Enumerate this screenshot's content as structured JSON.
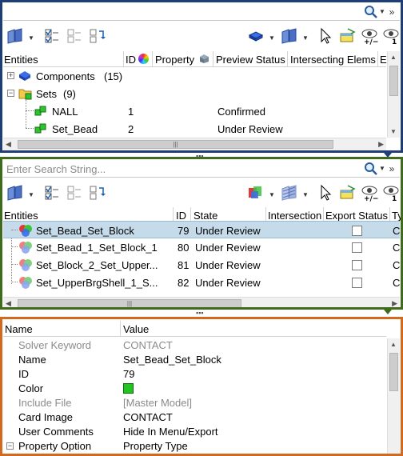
{
  "panel1": {
    "toolbar_icons": [
      "entity-view-icon",
      "check-all-icon",
      "check-none-icon",
      "reverse-check-icon",
      "cube-display-icon",
      "entity-filter-icon",
      "select-cursor-icon",
      "isolate-icon",
      "show-plus-minus-icon",
      "show-one-icon"
    ],
    "columns": [
      "Entities",
      "ID",
      "Property",
      "Preview Status",
      "Intersecting Elems",
      "Ex"
    ],
    "rows": [
      {
        "expander": "+",
        "name": "Components",
        "count": "(15)",
        "id": "",
        "status": ""
      },
      {
        "expander": "−",
        "name": "Sets",
        "count": "(9)",
        "id": "",
        "status": ""
      },
      {
        "expander": "",
        "name": "NALL",
        "count": "",
        "id": "1",
        "status": "Confirmed"
      },
      {
        "expander": "",
        "name": "Set_Bead",
        "count": "",
        "id": "2",
        "status": "Under Review"
      }
    ]
  },
  "panel2": {
    "search_placeholder": "Enter Search String...",
    "columns": [
      "Entities",
      "ID",
      "State",
      "Intersection",
      "Export Status",
      "Ty"
    ],
    "rows": [
      {
        "name": "Set_Bead_Set_Block",
        "id": "79",
        "state": "Under Review",
        "type": "C("
      },
      {
        "name": "Set_Bead_1_Set_Block_1",
        "id": "80",
        "state": "Under Review",
        "type": "C("
      },
      {
        "name": "Set_Block_2_Set_Upper...",
        "id": "81",
        "state": "Under Review",
        "type": "C("
      },
      {
        "name": "Set_UpperBrgShell_1_S...",
        "id": "82",
        "state": "Under Review",
        "type": "C("
      }
    ]
  },
  "panel3": {
    "columns": [
      "Name",
      "Value"
    ],
    "rows": [
      {
        "name": "Solver Keyword",
        "value": "CONTACT",
        "muted": true
      },
      {
        "name": "Name",
        "value": "Set_Bead_Set_Block",
        "muted": false
      },
      {
        "name": "ID",
        "value": "79",
        "muted": false
      },
      {
        "name": "Color",
        "value": "",
        "muted": false
      },
      {
        "name": "Include File",
        "value": "[Master Model]",
        "muted": true
      },
      {
        "name": "Card Image",
        "value": "CONTACT",
        "muted": false
      },
      {
        "name": "User Comments",
        "value": "Hide In Menu/Export",
        "muted": false
      },
      {
        "name": "Property Option",
        "value": "Property Type",
        "muted": false
      }
    ],
    "color_swatch": "#22c422"
  },
  "colors": {
    "panel1_border": "#1f3e78",
    "panel2_border": "#3e6b1c",
    "panel3_border": "#d2691e",
    "selection": "#c6dbe9"
  }
}
